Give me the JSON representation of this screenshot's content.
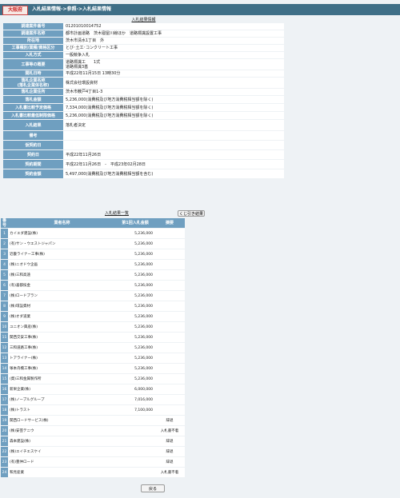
{
  "header": {
    "city": "大阪府",
    "breadcrumb": "入札結果情報->参照->入札結果情報"
  },
  "info_section_title": "入札結果情報",
  "info_rows": [
    {
      "label": "調達案件番号",
      "value": "01201010014752"
    },
    {
      "label": "調達案件名称",
      "value": "都市計画道路　茨木寝屋川線ほか　道路標識設置工事"
    },
    {
      "label": "所在地",
      "value": "茨木市清水1丁目　外"
    },
    {
      "label": "工事種別/業種/資格区分",
      "value": "とび･土工･コンクリート工事"
    },
    {
      "label": "入札方式",
      "value": "一般競争入札"
    },
    {
      "label": "工事等の概要",
      "value": "道路標識工　　1式\n道路標識3基"
    },
    {
      "label": "開札日時",
      "value": "平成22年11月15日 13時30分"
    },
    {
      "label": "落札企業名称\n(落札企業体名称)",
      "value": "株式会社環設資材"
    },
    {
      "label": "落札企業住所",
      "value": "茨木市薮戸4丁目1-3"
    },
    {
      "label": "落札金額",
      "value": "5,236,000(消費税及び地方消費税相当額を除く)"
    },
    {
      "label": "入札書比較予定価格",
      "value": "7,334,000(消費税及び地方消費税相当額を除く)"
    },
    {
      "label": "入札書比較最低制限価格",
      "value": "5,236,000(消費税及び地方消費税相当額を除く)"
    },
    {
      "label": "入札結果",
      "value": "落札者決定"
    },
    {
      "label": "備考",
      "value": ""
    },
    {
      "label": "仮契約日",
      "value": ""
    },
    {
      "label": "契約日",
      "value": "平成22年11月26日"
    },
    {
      "label": "契約期間",
      "value": "平成22年11月26日　-　平成23年02月28日"
    },
    {
      "label": "契約金額",
      "value": "5,497,000(消費税及び地方消費税相当額を含む)"
    }
  ],
  "results_section_title": "入札結果一覧",
  "reset_button": "くじ引き結果",
  "results_headers": [
    "番号",
    "業者名称",
    "第1回入札金額",
    "摘要"
  ],
  "results": [
    {
      "no": "1",
      "name": "カイエダ建設(株)",
      "amount": "5,236,000",
      "remark": ""
    },
    {
      "no": "2",
      "name": "(有)サン・ウエストジャパン",
      "amount": "5,236,000",
      "remark": ""
    },
    {
      "no": "3",
      "name": "近畿ライナー工事(株)",
      "amount": "5,236,000",
      "remark": ""
    },
    {
      "no": "4",
      "name": "(株)ニオドウ企画",
      "amount": "5,236,000",
      "remark": ""
    },
    {
      "no": "5",
      "name": "(株)三和高遠",
      "amount": "5,236,000",
      "remark": ""
    },
    {
      "no": "6",
      "name": "(有)喜都技金",
      "amount": "5,236,000",
      "remark": ""
    },
    {
      "no": "7",
      "name": "(株)ロードプラン",
      "amount": "5,236,000",
      "remark": ""
    },
    {
      "no": "8",
      "name": "(株)環設資材",
      "amount": "5,236,000",
      "remark": ""
    },
    {
      "no": "9",
      "name": "(株)オダ道業",
      "amount": "5,236,000",
      "remark": ""
    },
    {
      "no": "10",
      "name": "ユニオン興産(株)",
      "amount": "5,236,000",
      "remark": ""
    },
    {
      "no": "11",
      "name": "関西交安工事(株)",
      "amount": "5,236,000",
      "remark": ""
    },
    {
      "no": "12",
      "name": "三和道路工事(株)",
      "amount": "5,236,000",
      "remark": ""
    },
    {
      "no": "13",
      "name": "トアライナー(株)",
      "amount": "5,236,000",
      "remark": ""
    },
    {
      "no": "14",
      "name": "塚本舟橋工事(株)",
      "amount": "5,236,000",
      "remark": ""
    },
    {
      "no": "15",
      "name": "(資)三和金属製作所",
      "amount": "5,236,000",
      "remark": ""
    },
    {
      "no": "16",
      "name": "新栄企業(株)",
      "amount": "6,000,000",
      "remark": ""
    },
    {
      "no": "17",
      "name": "(株)ノーブルグループ",
      "amount": "7,016,000",
      "remark": ""
    },
    {
      "no": "18",
      "name": "(株)トラスト",
      "amount": "7,100,000",
      "remark": ""
    },
    {
      "no": "19",
      "name": "関西ロードサービス(株)",
      "amount": "",
      "remark": "辞退"
    },
    {
      "no": "20",
      "name": "(株)安芸テニウ",
      "amount": "",
      "remark": "入札書不着"
    },
    {
      "no": "21",
      "name": "森本建設(株)",
      "amount": "",
      "remark": "辞退"
    },
    {
      "no": "22",
      "name": "(株)エイチエスケイ",
      "amount": "",
      "remark": "辞退"
    },
    {
      "no": "23",
      "name": "(有)豊仲ロード",
      "amount": "",
      "remark": "辞退"
    },
    {
      "no": "24",
      "name": "和見産業",
      "amount": "",
      "remark": "入札書不着"
    }
  ],
  "back_button": "戻る"
}
